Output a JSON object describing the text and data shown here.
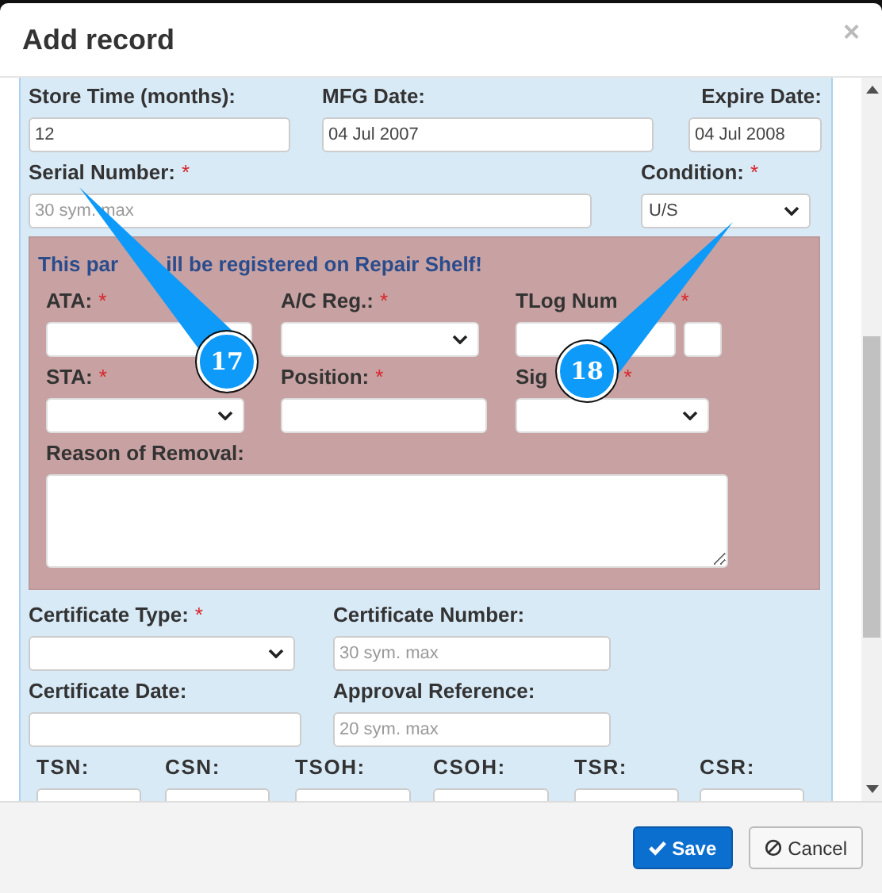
{
  "dialog": {
    "title": "Add record",
    "close": "×"
  },
  "sections": [
    {
      "kind": "plain",
      "rows": [
        [
          {
            "label": "Store Time (months):",
            "kind": "input",
            "value": "12"
          },
          {
            "label": "MFG Date:",
            "kind": "input",
            "value": "04 Jul 2007"
          },
          {
            "label": "Expire Date:",
            "kind": "input",
            "value": "04 Jul 2008"
          }
        ],
        [
          {
            "label": "Serial Number:",
            "required_mark": "*",
            "kind": "input",
            "placeholder": "30 sym. max"
          },
          {
            "label": "Condition:",
            "required_mark": "*",
            "kind": "select",
            "value": "U/S"
          }
        ]
      ]
    },
    {
      "kind": "repair",
      "message_parts": [
        "This par",
        "ill be registered on Repair Shelf!"
      ],
      "rows": [
        [
          {
            "label": "ATA:",
            "required_mark": "*",
            "kind": "input"
          },
          {
            "label": "A/C Reg.:",
            "required_mark": "*",
            "kind": "select"
          },
          {
            "label": "TLog Num",
            "required_mark": "*",
            "kind": "input_pair"
          }
        ],
        [
          {
            "label": "STA:",
            "required_mark": "*",
            "kind": "select"
          },
          {
            "label": "Position:",
            "required_mark": "*",
            "kind": "input"
          },
          {
            "label": "Sig",
            "required_mark": "*",
            "kind": "select"
          }
        ],
        [
          {
            "label": "Reason of Removal:",
            "kind": "textarea"
          }
        ]
      ]
    },
    {
      "kind": "plain",
      "rows": [
        [
          {
            "label": "Certificate Type:",
            "required_mark": "*",
            "kind": "select"
          },
          {
            "label": "Certificate Number:",
            "kind": "input",
            "placeholder": "30 sym. max"
          }
        ],
        [
          {
            "label": "Certificate Date:",
            "kind": "input"
          },
          {
            "label": "Approval Reference:",
            "kind": "input",
            "placeholder": "20 sym. max"
          }
        ]
      ]
    },
    {
      "kind": "counters",
      "rows": [
        [
          {
            "label": "TSN:",
            "kind": "input"
          },
          {
            "label": "CSN:",
            "kind": "input"
          },
          {
            "label": "TSOH:",
            "kind": "input"
          },
          {
            "label": "CSOH:",
            "kind": "input"
          },
          {
            "label": "TSR:",
            "kind": "input"
          },
          {
            "label": "CSR:",
            "kind": "input"
          }
        ]
      ]
    }
  ],
  "buttons": [
    {
      "label": "Save",
      "kind": "primary"
    },
    {
      "label": "Cancel",
      "kind": "cancel"
    }
  ],
  "callouts": [
    {
      "number": "17"
    },
    {
      "number": "18"
    }
  ]
}
